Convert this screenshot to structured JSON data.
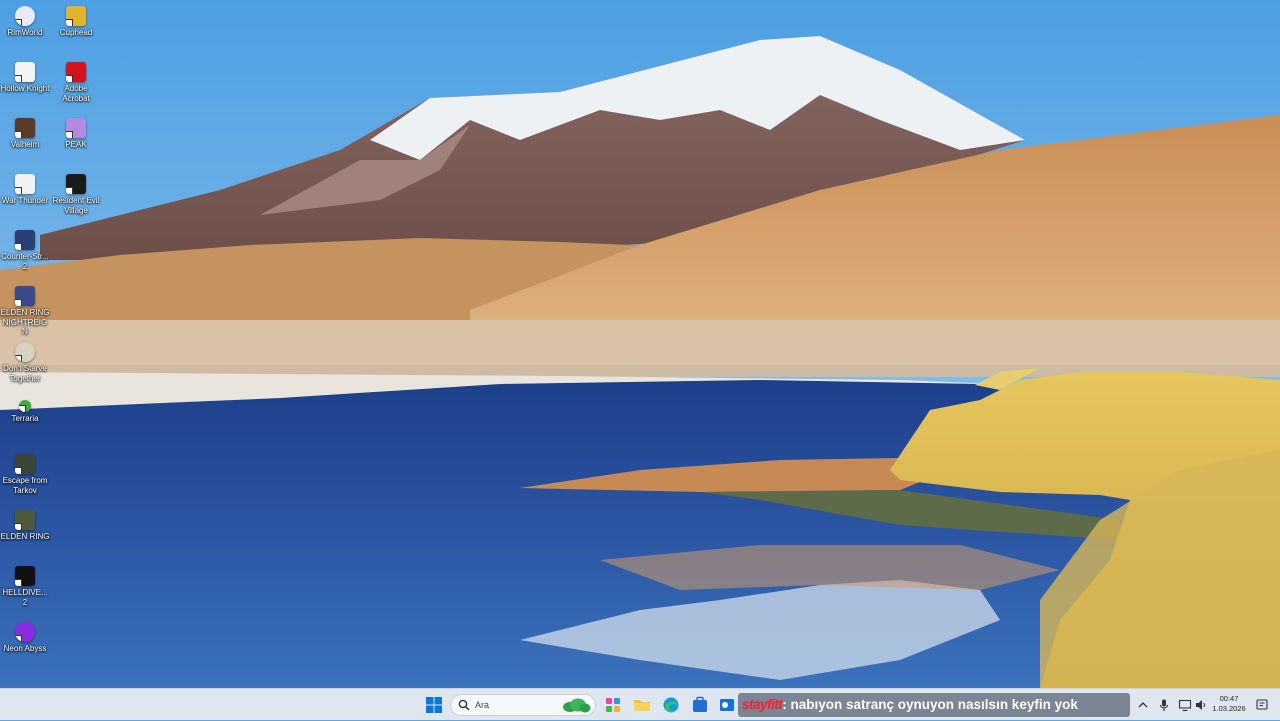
{
  "desktop": {
    "icons": [
      {
        "label": "RimWorld",
        "icon": "rimworld-icon"
      },
      {
        "label": "Cuphead",
        "icon": "cuphead-icon"
      },
      {
        "label": "Hollow Knight",
        "icon": "hollow-knight-icon"
      },
      {
        "label": "Adobe Acrobat",
        "icon": "adobe-acrobat-icon"
      },
      {
        "label": "Valheim",
        "icon": "valheim-icon"
      },
      {
        "label": "PEAK",
        "icon": "peak-icon"
      },
      {
        "label": "War Thunder",
        "icon": "war-thunder-icon"
      },
      {
        "label": "Resident Evil Village",
        "icon": "resident-evil-village-icon"
      },
      {
        "label": "Counter-Str... 2",
        "icon": "counter-strike-2-icon"
      },
      {
        "label": "ELDEN RING NIGHTREIGN",
        "icon": "elden-ring-nightreign-icon"
      },
      {
        "label": "Don't Starve Together",
        "icon": "dont-starve-together-icon"
      },
      {
        "label": "Terraria",
        "icon": "terraria-icon"
      },
      {
        "label": "Escape from Tarkov",
        "icon": "escape-from-tarkov-icon"
      },
      {
        "label": "ELDEN RING",
        "icon": "elden-ring-icon"
      },
      {
        "label": "HELLDIVE... 2",
        "icon": "helldivers-2-icon"
      },
      {
        "label": "Neon Abyss",
        "icon": "neon-abyss-icon"
      }
    ]
  },
  "taskbar": {
    "start_icon": "windows-start-icon",
    "search": {
      "placeholder": "Ara",
      "icon": "search-icon",
      "highlight_icon": "cloud-icon"
    },
    "pinned": [
      {
        "name": "widgets",
        "icon": "widgets-icon"
      },
      {
        "name": "file-explorer",
        "icon": "folder-icon"
      },
      {
        "name": "edge",
        "icon": "edge-icon"
      },
      {
        "name": "store",
        "icon": "store-icon"
      },
      {
        "name": "outlook",
        "icon": "outlook-icon"
      }
    ],
    "overlay": {
      "user": "stayfitt",
      "message": ": nabıyon satranç oynuyon nasılsın keyfin yok"
    },
    "tray": {
      "chevron_icon": "chevron-up-icon",
      "mic_icon": "microphone-icon",
      "network_icon": "network-icon",
      "volume_icon": "speaker-icon",
      "time": "00:47",
      "date": "1.03.2026",
      "notification_icon": "notification-icon"
    },
    "colors": {
      "taskbar_bg": "#dfe6ef",
      "accent": "#0078d4",
      "overlay_user": "#ff1a2e"
    }
  },
  "wallpaper": {
    "subject": "mountain-lake-wallpaper"
  }
}
